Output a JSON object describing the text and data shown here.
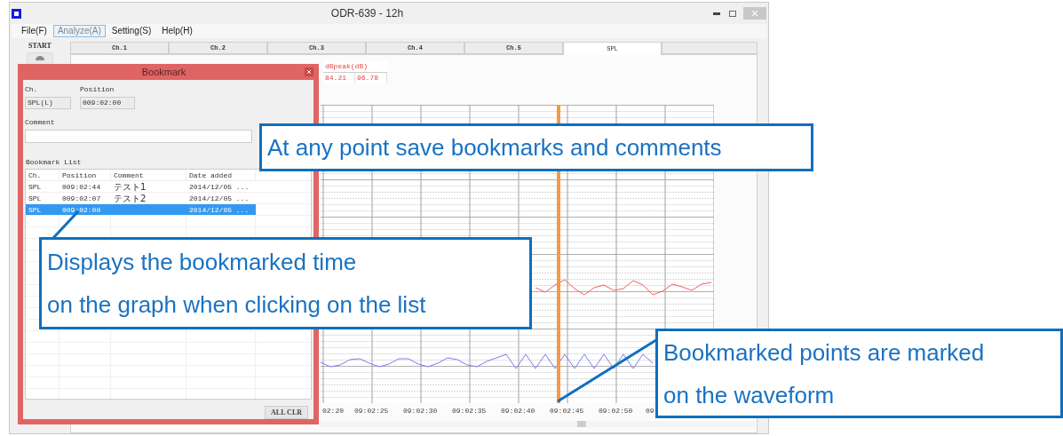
{
  "window": {
    "title": "ODR-639 - 12h"
  },
  "menu": [
    {
      "label": "File(F)",
      "selected": false
    },
    {
      "label": "Analyze(A)",
      "selected": true
    },
    {
      "label": "Setting(S)",
      "selected": false
    },
    {
      "label": "Help(H)",
      "selected": false
    }
  ],
  "start_label": "START",
  "tabs": [
    {
      "label": "Ch.1",
      "selected": false
    },
    {
      "label": "Ch.2",
      "selected": false
    },
    {
      "label": "Ch.3",
      "selected": false
    },
    {
      "label": "Ch.4",
      "selected": false
    },
    {
      "label": "Ch.5",
      "selected": false
    },
    {
      "label": "SPL",
      "selected": true
    }
  ],
  "summary": {
    "header": "dBpeak(dB)",
    "values": [
      "84.21",
      "96.78"
    ]
  },
  "chart": {
    "time_labels": [
      "02:20",
      "09:02:25",
      "09:02:30",
      "09:02:35",
      "09:02:40",
      "09:02:45",
      "09:02:50",
      "09"
    ]
  },
  "bookmark_dialog": {
    "title": "Bookmark",
    "ch_label": "Ch.",
    "ch_value": "SPL(L)",
    "position_label": "Position",
    "position_value": "009:02:00",
    "comment_label": "Comment",
    "list_label": "Bookmark List",
    "columns": [
      "Ch.",
      "Position",
      "Comment",
      "Date added"
    ],
    "rows": [
      {
        "ch": "SPL",
        "position": "009:02:44",
        "comment": "テスト1",
        "date": "2014/12/05 ...",
        "selected": false
      },
      {
        "ch": "SPL",
        "position": "009:02:07",
        "comment": "テスト2",
        "date": "2014/12/05 ...",
        "selected": false
      },
      {
        "ch": "SPL",
        "position": "009:02:00",
        "date": "2014/12/05 ...",
        "selected": true
      }
    ],
    "clear_button": "ALL CLR"
  },
  "callouts": [
    {
      "lines": [
        "At any point save bookmarks and comments"
      ]
    },
    {
      "lines": [
        "Displays the bookmarked time",
        "on the graph when clicking on the list"
      ]
    },
    {
      "lines": [
        "Bookmarked points are marked",
        "on the waveform"
      ]
    }
  ]
}
